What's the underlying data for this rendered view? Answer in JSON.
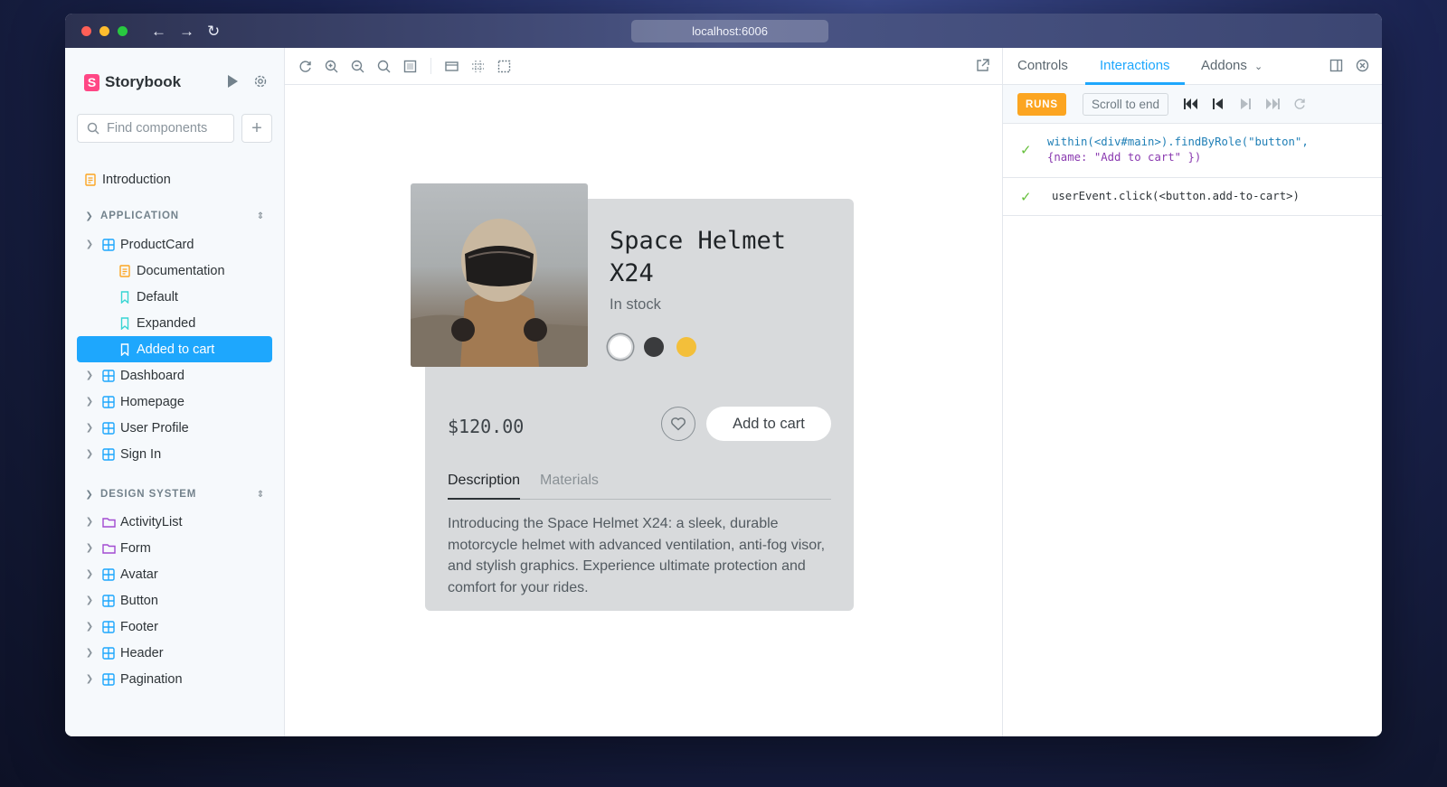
{
  "browser": {
    "url": "localhost:6006"
  },
  "sidebar": {
    "brand": "Storybook",
    "search_placeholder": "Find components",
    "intro": "Introduction",
    "sections": [
      {
        "title": "APPLICATION"
      },
      {
        "title": "DESIGN SYSTEM"
      }
    ],
    "app_items": [
      "ProductCard",
      "Documentation",
      "Default",
      "Expanded",
      "Added to cart",
      "Dashboard",
      "Homepage",
      "User Profile",
      "Sign In"
    ],
    "ds_items": [
      "ActivityList",
      "Form",
      "Avatar",
      "Button",
      "Footer",
      "Header",
      "Pagination"
    ]
  },
  "product": {
    "title": "Space Helmet X24",
    "stock": "In stock",
    "price": "$120.00",
    "add_to_cart": "Add to cart",
    "tabs": [
      "Description",
      "Materials"
    ],
    "description": "Introducing the Space Helmet X24: a sleek, durable motorcycle helmet with advanced ventilation, anti-fog visor, and stylish graphics. Experience ultimate protection and comfort for your rides.",
    "swatch_colors": [
      "#ffffff",
      "#3a3b3d",
      "#f3bf3a"
    ]
  },
  "panel": {
    "tabs": [
      "Controls",
      "Interactions",
      "Addons"
    ],
    "runs": "RUNS",
    "scroll_to_end": "Scroll to end",
    "interactions": [
      {
        "line1": "within(<div#main>).findByRole(\"button\",",
        "line2": "{name: \"Add to cart\" })"
      },
      {
        "line1": "userEvent.click(<button.add-to-cart>)"
      }
    ]
  },
  "colors": {
    "accent": "#1ea7fd",
    "brand": "#ff4785",
    "runs": "#fca521",
    "pass": "#66bf3c"
  }
}
